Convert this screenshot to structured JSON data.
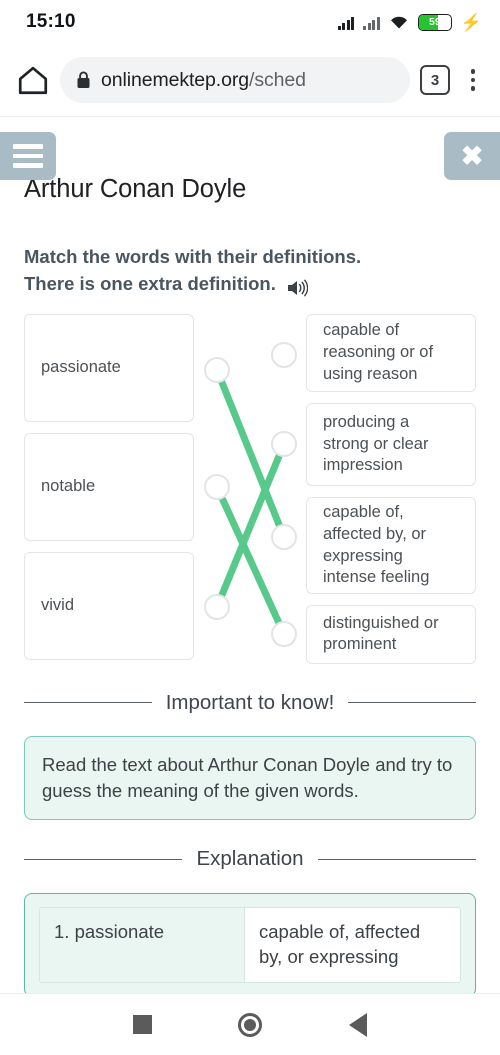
{
  "status_bar": {
    "time": "15:10",
    "battery_percent": "59",
    "battery_level": 59,
    "charging_icon": "⚡",
    "icons": [
      "signal-icon",
      "signal-secondary-icon",
      "wifi-icon",
      "battery-icon",
      "charging-bolt-icon"
    ]
  },
  "browser": {
    "home_icon": "home-icon",
    "lock_icon": "lock-icon",
    "url_domain": "onlinemektep.org",
    "url_path": "/sched",
    "tab_count": "3",
    "menu_icon": "kebab-menu-icon"
  },
  "header": {
    "menu_label": "☰",
    "close_label": "✖",
    "title": "Arthur Conan Doyle",
    "accent_button_color": "#a9bcc6"
  },
  "task": {
    "line1": "Match the words with their definitions.",
    "line2": "There is one extra definition.",
    "audio_icon": "speaker-icon"
  },
  "match": {
    "line_color": "#57c98a",
    "words": [
      {
        "id": 1,
        "label": "passionate"
      },
      {
        "id": 2,
        "label": "notable"
      },
      {
        "id": 3,
        "label": "vivid"
      }
    ],
    "definitions": [
      {
        "id": 1,
        "label": "capable of reasoning or of using reason"
      },
      {
        "id": 2,
        "label": "producing a strong or clear impression"
      },
      {
        "id": 3,
        "label": "capable of, affected by, or expressing intense feeling"
      },
      {
        "id": 4,
        "label": "distinguished or prominent"
      }
    ],
    "connections": [
      {
        "from": 1,
        "to": 3
      },
      {
        "from": 2,
        "to": 4
      },
      {
        "from": 3,
        "to": 2
      }
    ]
  },
  "important": {
    "heading": "Important to know!",
    "body": "Read the text about Arthur Conan Doyle and try to guess the meaning of the given words."
  },
  "explanation": {
    "heading": "Explanation",
    "rows": [
      {
        "word": "1. passionate",
        "definition": "capable of, affected by, or expressing"
      }
    ]
  },
  "navigation": {
    "recents_icon": "square-recents-icon",
    "home_icon": "circle-home-icon",
    "back_icon": "triangle-back-icon"
  }
}
